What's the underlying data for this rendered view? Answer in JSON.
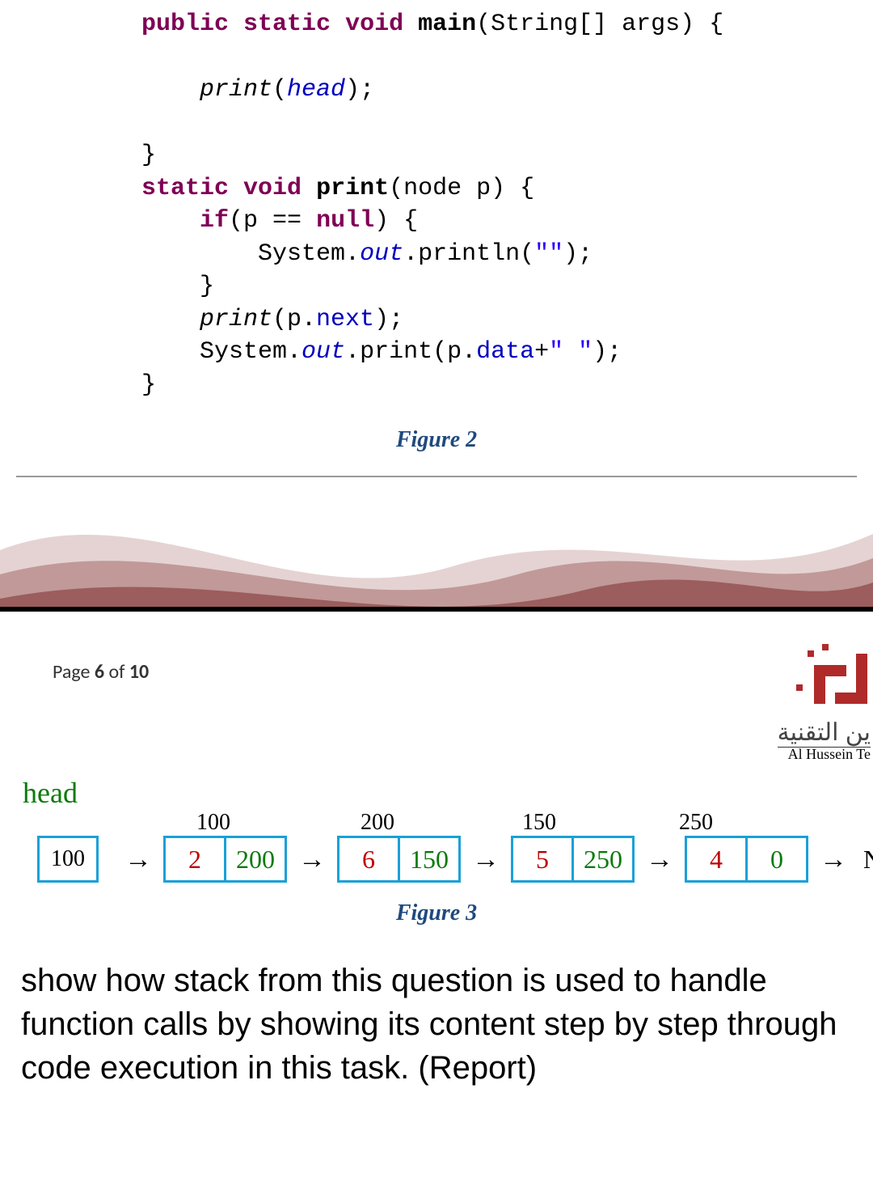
{
  "code": {
    "l1_public": "public",
    "l1_static": "static",
    "l1_void": "void",
    "l1_main": "main",
    "l1_rest": "(String[] args) {",
    "l2_print": "print",
    "l2_head": "head",
    "l3_close": "}",
    "l4_static": "static",
    "l4_void": "void",
    "l4_print": "print",
    "l4_rest": "(node p) {",
    "l5_if": "if",
    "l5_cond1": "(p == ",
    "l5_null": "null",
    "l5_cond2": ") {",
    "l6_sys": "System.",
    "l6_out": "out",
    "l6_printlnA": ".println(",
    "l6_str": "\"\"",
    "l6_printlnB": ");",
    "l7_close": "}",
    "l8_print": "print",
    "l8_mem": "next",
    "l9_sys": "System.",
    "l9_out": "out",
    "l9_print": ".print(p.",
    "l9_mem": "data",
    "l9_plus": "+",
    "l9_str": "\" \"",
    "l9_end": ");",
    "l10_close": "}"
  },
  "fig2_caption": "Figure 2",
  "page_info": {
    "prefix": "Page ",
    "cur": "6",
    "mid": " of ",
    "total": "10"
  },
  "logo": {
    "arabic": "ين التقنية",
    "sub": "Al Hussein Te"
  },
  "fig3": {
    "head_label": "head",
    "head_value": "100",
    "nodes": [
      {
        "addr": "100",
        "data": "2",
        "next": "200"
      },
      {
        "addr": "200",
        "data": "6",
        "next": "150"
      },
      {
        "addr": "150",
        "data": "5",
        "next": "250"
      },
      {
        "addr": "250",
        "data": "4",
        "next": "0"
      }
    ],
    "null": "NULL"
  },
  "fig3_caption": "Figure 3",
  "question": "show how stack from this question is used to handle function calls by showing its content step by step through code execution in this task. (Report)"
}
